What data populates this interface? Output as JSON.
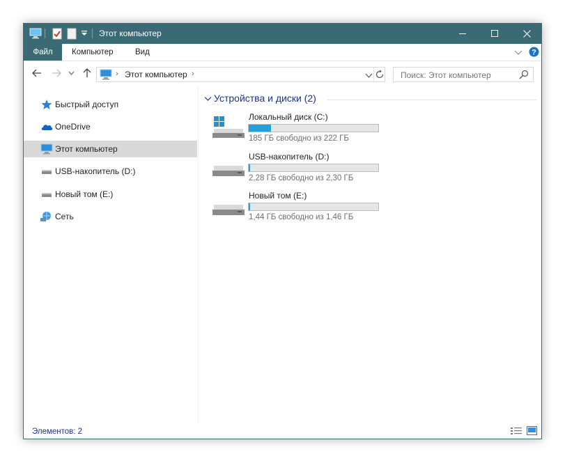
{
  "window": {
    "title": "Этот компьютер"
  },
  "ribbon": {
    "tabs": [
      {
        "label": "Файл",
        "active": true
      },
      {
        "label": "Компьютер",
        "active": false
      },
      {
        "label": "Вид",
        "active": false
      }
    ]
  },
  "address": {
    "path": "Этот компьютер"
  },
  "search": {
    "placeholder": "Поиск: Этот компьютер"
  },
  "nav": {
    "items": [
      {
        "label": "Быстрый доступ",
        "icon": "star-icon"
      },
      {
        "label": "OneDrive",
        "icon": "cloud-icon"
      },
      {
        "label": "Этот компьютер",
        "icon": "computer-icon",
        "selected": true
      },
      {
        "label": "USB-накопитель (D:)",
        "icon": "usb-drive-icon"
      },
      {
        "label": "Новый том (E:)",
        "icon": "drive-icon"
      },
      {
        "label": "Сеть",
        "icon": "network-icon"
      }
    ]
  },
  "group": {
    "title": "Устройства и диски (2)"
  },
  "drives": [
    {
      "name": "Локальный диск (C:)",
      "info": "185 ГБ свободно из 222 ГБ",
      "used_fraction": 0.17,
      "system": true
    },
    {
      "name": "USB-накопитель (D:)",
      "info": "2,28 ГБ свободно из 2,30 ГБ",
      "used_fraction": 0.01,
      "system": false
    },
    {
      "name": "Новый том (E:)",
      "info": "1,44 ГБ свободно из 1,46 ГБ",
      "used_fraction": 0.01,
      "system": false
    }
  ],
  "status": {
    "items_count": "Элементов: 2"
  },
  "colors": {
    "titlebar": "#3a6a74",
    "accent": "#26a0da",
    "header_text": "#1e3287"
  }
}
